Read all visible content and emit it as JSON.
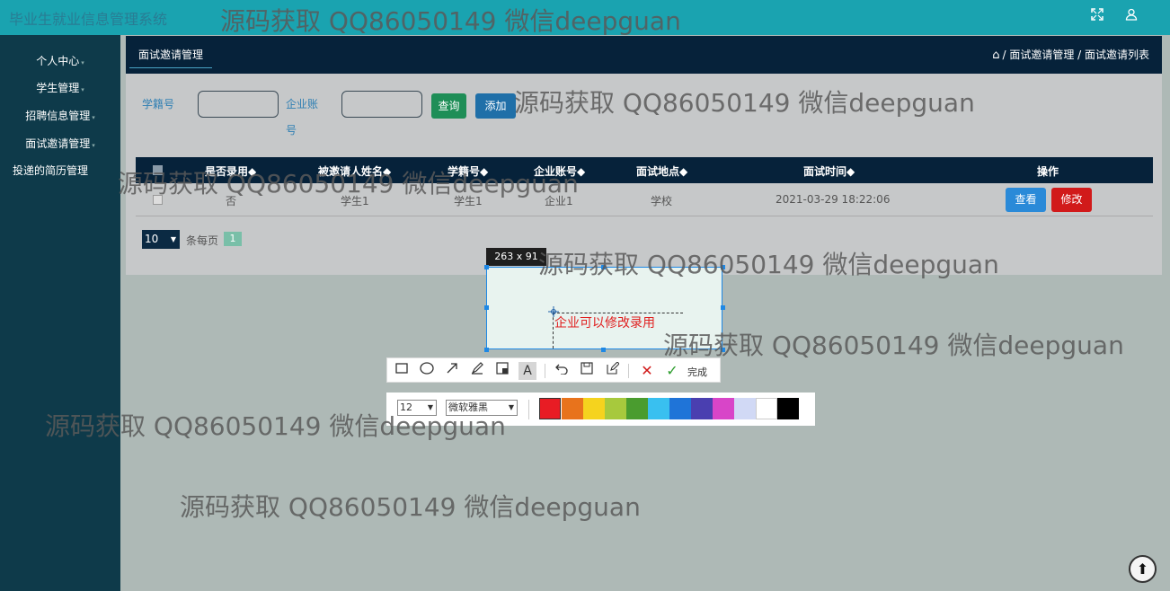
{
  "app": {
    "title": "毕业生就业信息管理系统"
  },
  "topbar": {
    "fullscreen_icon": "expand-icon",
    "user_icon": "user-icon"
  },
  "sidebar": {
    "items": [
      {
        "label": "个人中心"
      },
      {
        "label": "学生管理"
      },
      {
        "label": "招聘信息管理"
      },
      {
        "label": "面试邀请管理"
      },
      {
        "label": "投递的简历管理"
      }
    ]
  },
  "main": {
    "tab_label": "面试邀请管理",
    "breadcrumb": {
      "home_icon": "home-icon",
      "text": "/ 面试邀请管理 / 面试邀请列表"
    },
    "search": {
      "student_no_label": "学籍号",
      "student_no_value": "",
      "company_label_line1": "企业账",
      "company_label_line2": "号",
      "company_value": "",
      "query_button": "查询",
      "add_button": "添加"
    },
    "table": {
      "headers": [
        "是否录用◆",
        "被邀请人姓名◆",
        "学籍号◆",
        "企业账号◆",
        "面试地点◆",
        "面试时间◆",
        "操作"
      ],
      "rows": [
        {
          "hired": "否",
          "name": "学生1",
          "student_no": "学生1",
          "company": "企业1",
          "place": "学校",
          "time": "2021-03-29 18:22:06",
          "view": "查看",
          "edit": "修改"
        }
      ]
    },
    "pager": {
      "page_size": "10",
      "per_page_label": "条每页",
      "current_page": "1"
    }
  },
  "capture_tool": {
    "size_label": "263 x 91",
    "annotation_text": "企业可以修改录用",
    "done_label": "完成",
    "font_size": "12",
    "font_name": "微软雅黑",
    "colors": [
      "#e81c24",
      "#e8731c",
      "#f5d31e",
      "#a7c93d",
      "#4a9c2f",
      "#39c0f0",
      "#1f74d8",
      "#4a3fb0",
      "#d845c8",
      "#d1d9f5",
      "#ffffff",
      "#000000"
    ],
    "selected_color": "#e81c24"
  },
  "watermark": {
    "text": "源码获取 QQ86050149 微信deepguan"
  }
}
